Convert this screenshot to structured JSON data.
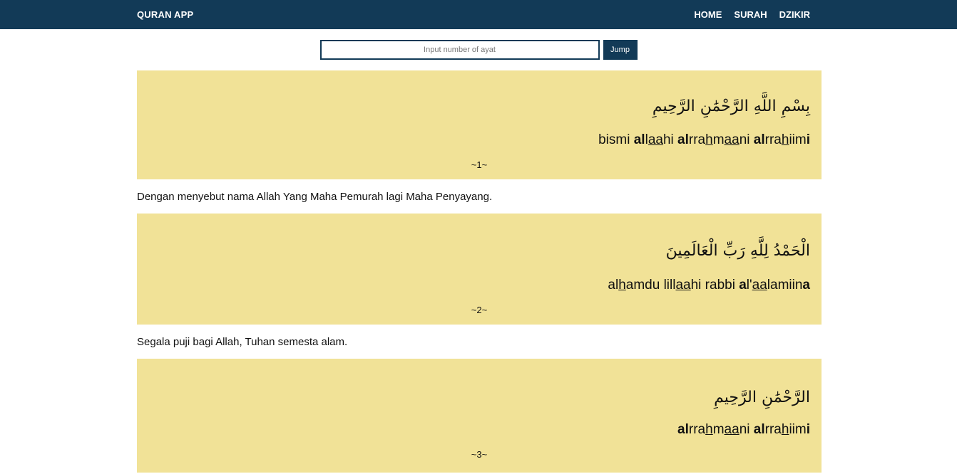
{
  "navbar": {
    "brand": "QURAN APP",
    "links": [
      {
        "label": "HOME"
      },
      {
        "label": "SURAH"
      },
      {
        "label": "DZIKIR"
      }
    ]
  },
  "search": {
    "placeholder": "Input number of ayat",
    "value": "",
    "button_label": "Jump"
  },
  "ayat": [
    {
      "arabic": "بِسْمِ اللَّهِ الرَّحْمَٰنِ الرَّحِيمِ",
      "latin_html": "bismi <b>al</b>l<u>aa</u>hi <b>al</b>rra<u>h</u>m<u>aa</u>ni <b>al</b>rra<u>h</u>iim<b>i</b>",
      "number": "~1~",
      "translation": "Dengan menyebut nama Allah Yang Maha Pemurah lagi Maha Penyayang."
    },
    {
      "arabic": "الْحَمْدُ لِلَّهِ رَبِّ الْعَالَمِينَ",
      "latin_html": "al<u>h</u>amdu lill<u>aa</u>hi rabbi <b>a</b>l'<u>aa</u>lamiin<b>a</b>",
      "number": "~2~",
      "translation": "Segala puji bagi Allah, Tuhan semesta alam."
    },
    {
      "arabic": "الرَّحْمَٰنِ الرَّحِيمِ",
      "latin_html": "<b>al</b>rra<u>h</u>m<u>aa</u>ni <b>al</b>rra<u>h</u>iim<b>i</b>",
      "number": "~3~",
      "translation": ""
    }
  ],
  "colors": {
    "navbar": "#123a57",
    "card": "#f1e297"
  }
}
